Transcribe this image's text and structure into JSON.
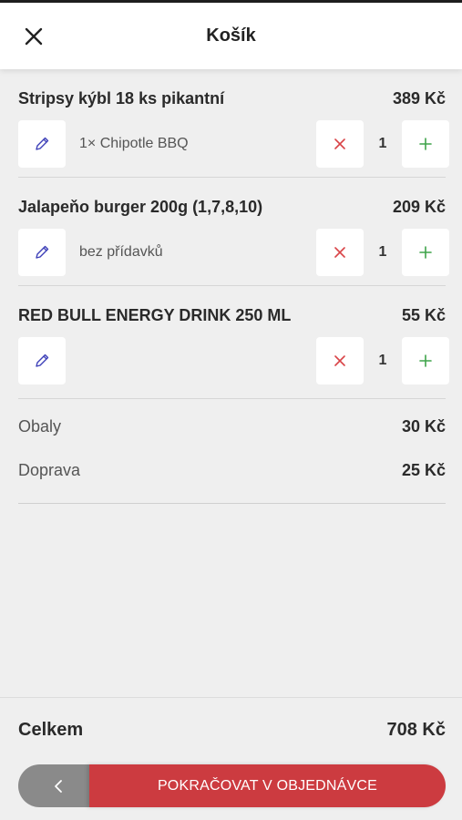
{
  "header": {
    "title": "Košík",
    "close_icon": "close-icon"
  },
  "colors": {
    "accent": "#cc3b40",
    "remove": "#d94448",
    "add": "#3fa44a",
    "edit": "#3d3fb8",
    "back_button": "#8a8a8a"
  },
  "cart": {
    "items": [
      {
        "name": "Stripsy kýbl 18 ks pikantní",
        "price": "389 Kč",
        "description": "1× Chipotle BBQ",
        "quantity": "1"
      },
      {
        "name": "Jalapeňo burger 200g (1,7,8,10)",
        "price": "209 Kč",
        "description": "bez přídavků",
        "quantity": "1"
      },
      {
        "name": "RED BULL ENERGY DRINK 250 ML",
        "price": "55 Kč",
        "description": "",
        "quantity": "1"
      }
    ]
  },
  "summary": {
    "packaging_label": "Obaly",
    "packaging_value": "30 Kč",
    "delivery_label": "Doprava",
    "delivery_value": "25 Kč"
  },
  "footer": {
    "total_label": "Celkem",
    "total_value": "708 Kč",
    "continue_label": "POKRAČOVAT V OBJEDNÁVCE",
    "back_icon": "chevron-left-icon"
  }
}
